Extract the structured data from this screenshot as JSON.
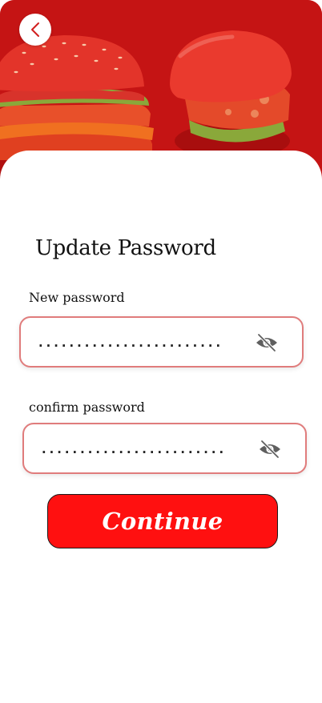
{
  "header": {
    "back_icon": "chevron-left-icon",
    "accent_color": "#c51414",
    "image_subject": "burgers"
  },
  "form": {
    "title": "Update Password",
    "new_password": {
      "label": "New password",
      "value": "........................",
      "toggle_icon": "eye-off-icon"
    },
    "confirm_password": {
      "label": "confirm password",
      "value": "........................",
      "toggle_icon": "eye-off-icon"
    },
    "continue_label": "Continue",
    "field_border_color": "#e07c7c",
    "button_color": "#ff1010"
  }
}
